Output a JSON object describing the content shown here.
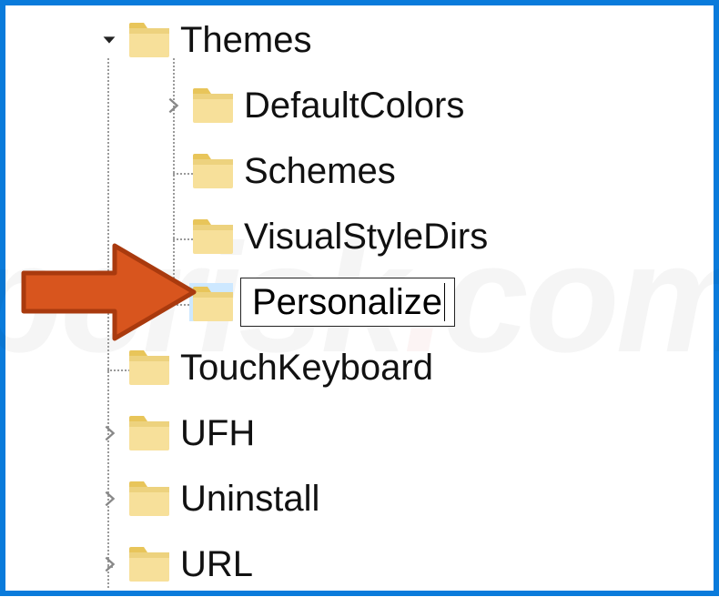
{
  "tree": {
    "root_label": "Themes",
    "children": [
      {
        "label": "DefaultColors",
        "expandable": true
      },
      {
        "label": "Schemes",
        "expandable": false
      },
      {
        "label": "VisualStyleDirs",
        "expandable": false
      },
      {
        "label": "Personalize",
        "expandable": false,
        "editing": true,
        "highlighted": true
      }
    ]
  },
  "siblings_after": [
    {
      "label": "TouchKeyboard",
      "expandable": false
    },
    {
      "label": "UFH",
      "expandable": true
    },
    {
      "label": "Uninstall",
      "expandable": true
    },
    {
      "label": "URL",
      "expandable": true
    }
  ],
  "icons": {
    "chevron_down": "chevron-down",
    "chevron_right": "chevron-right",
    "folder": "folder"
  },
  "annotation": {
    "arrow_color": "#d8551e",
    "arrow_stroke": "#a93a0e"
  }
}
